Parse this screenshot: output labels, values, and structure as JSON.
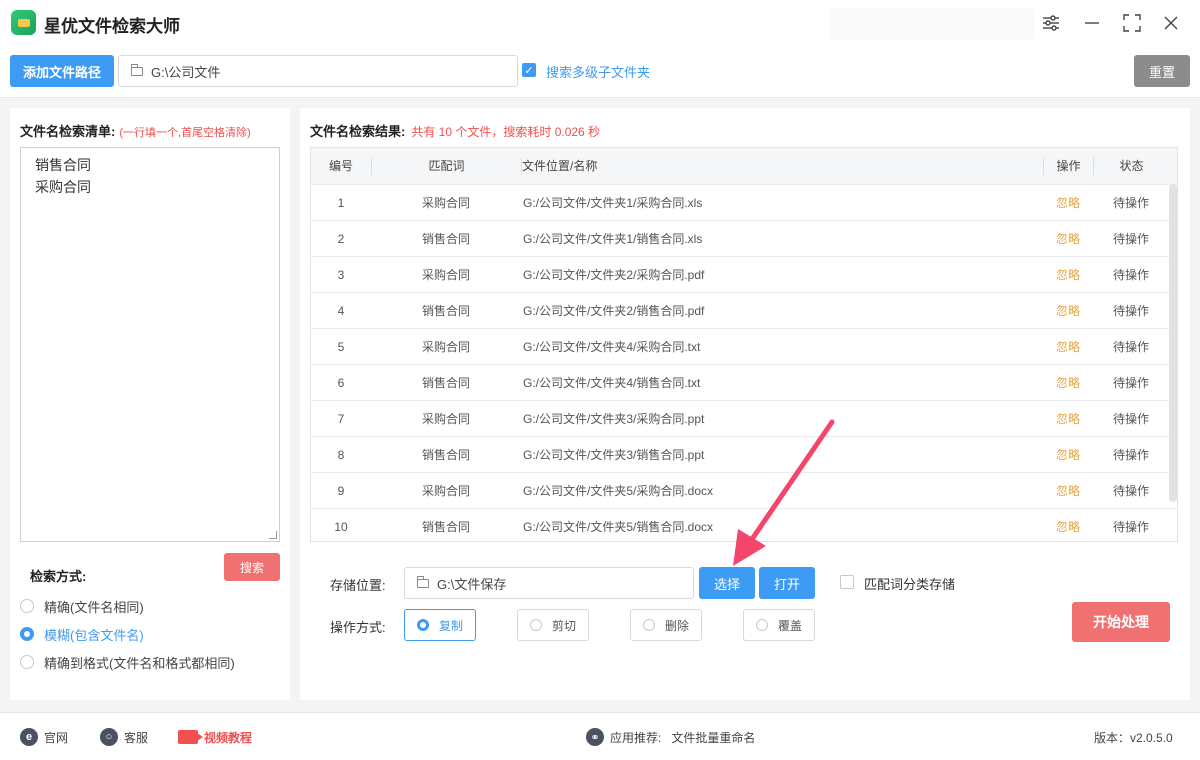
{
  "app": {
    "title": "星优文件检索大师"
  },
  "toolbar": {
    "add_path_label": "添加文件路径",
    "path_value": "G:\\公司文件",
    "subfolder_checkbox_label": "搜索多级子文件夹",
    "subfolder_checked": true,
    "reset_label": "重置"
  },
  "left": {
    "title": "文件名检索清单:",
    "hint": "(一行填一个,首尾空格清除)",
    "keywords": [
      "销售合同",
      "采购合同"
    ],
    "mode_label": "检索方式:",
    "search_label": "搜索",
    "modes": [
      {
        "label": "精确(文件名相同)",
        "selected": false
      },
      {
        "label": "模糊(包含文件名)",
        "selected": true
      },
      {
        "label": "精确到格式(文件名和格式都相同)",
        "selected": false
      }
    ]
  },
  "right": {
    "title": "文件名检索结果:",
    "summary": "共有 10 个文件，搜索耗时 0.026 秒",
    "columns": {
      "no": "编号",
      "keyword": "匹配词",
      "path": "文件位置/名称",
      "op": "操作",
      "status": "状态"
    },
    "rows": [
      {
        "no": "1",
        "keyword": "采购合同",
        "path": "G:/公司文件/文件夹1/采购合同.xls",
        "op": "忽略",
        "status": "待操作"
      },
      {
        "no": "2",
        "keyword": "销售合同",
        "path": "G:/公司文件/文件夹1/销售合同.xls",
        "op": "忽略",
        "status": "待操作"
      },
      {
        "no": "3",
        "keyword": "采购合同",
        "path": "G:/公司文件/文件夹2/采购合同.pdf",
        "op": "忽略",
        "status": "待操作"
      },
      {
        "no": "4",
        "keyword": "销售合同",
        "path": "G:/公司文件/文件夹2/销售合同.pdf",
        "op": "忽略",
        "status": "待操作"
      },
      {
        "no": "5",
        "keyword": "采购合同",
        "path": "G:/公司文件/文件夹4/采购合同.txt",
        "op": "忽略",
        "status": "待操作"
      },
      {
        "no": "6",
        "keyword": "销售合同",
        "path": "G:/公司文件/文件夹4/销售合同.txt",
        "op": "忽略",
        "status": "待操作"
      },
      {
        "no": "7",
        "keyword": "采购合同",
        "path": "G:/公司文件/文件夹3/采购合同.ppt",
        "op": "忽略",
        "status": "待操作"
      },
      {
        "no": "8",
        "keyword": "销售合同",
        "path": "G:/公司文件/文件夹3/销售合同.ppt",
        "op": "忽略",
        "status": "待操作"
      },
      {
        "no": "9",
        "keyword": "采购合同",
        "path": "G:/公司文件/文件夹5/采购合同.docx",
        "op": "忽略",
        "status": "待操作"
      },
      {
        "no": "10",
        "keyword": "销售合同",
        "path": "G:/公司文件/文件夹5/销售合同.docx",
        "op": "忽略",
        "status": "待操作"
      }
    ],
    "save_label": "存储位置:",
    "save_path": "G:\\文件保存",
    "choose_label": "选择",
    "open_label": "打开",
    "classify_label": "匹配词分类存储",
    "classify_checked": false,
    "op_mode_label": "操作方式:",
    "op_modes": [
      {
        "label": "复制",
        "selected": true
      },
      {
        "label": "剪切",
        "selected": false
      },
      {
        "label": "删除",
        "selected": false
      },
      {
        "label": "覆盖",
        "selected": false
      }
    ],
    "start_label": "开始处理"
  },
  "footer": {
    "website": "官网",
    "support": "客服",
    "video": "视频教程",
    "recommend_label": "应用推荐:",
    "recommend_app": "文件批量重命名",
    "version": "版本：v2.0.5.0"
  },
  "colors": {
    "accent": "#3d9bf3",
    "danger": "#f07171",
    "op_link": "#e8a33c"
  }
}
